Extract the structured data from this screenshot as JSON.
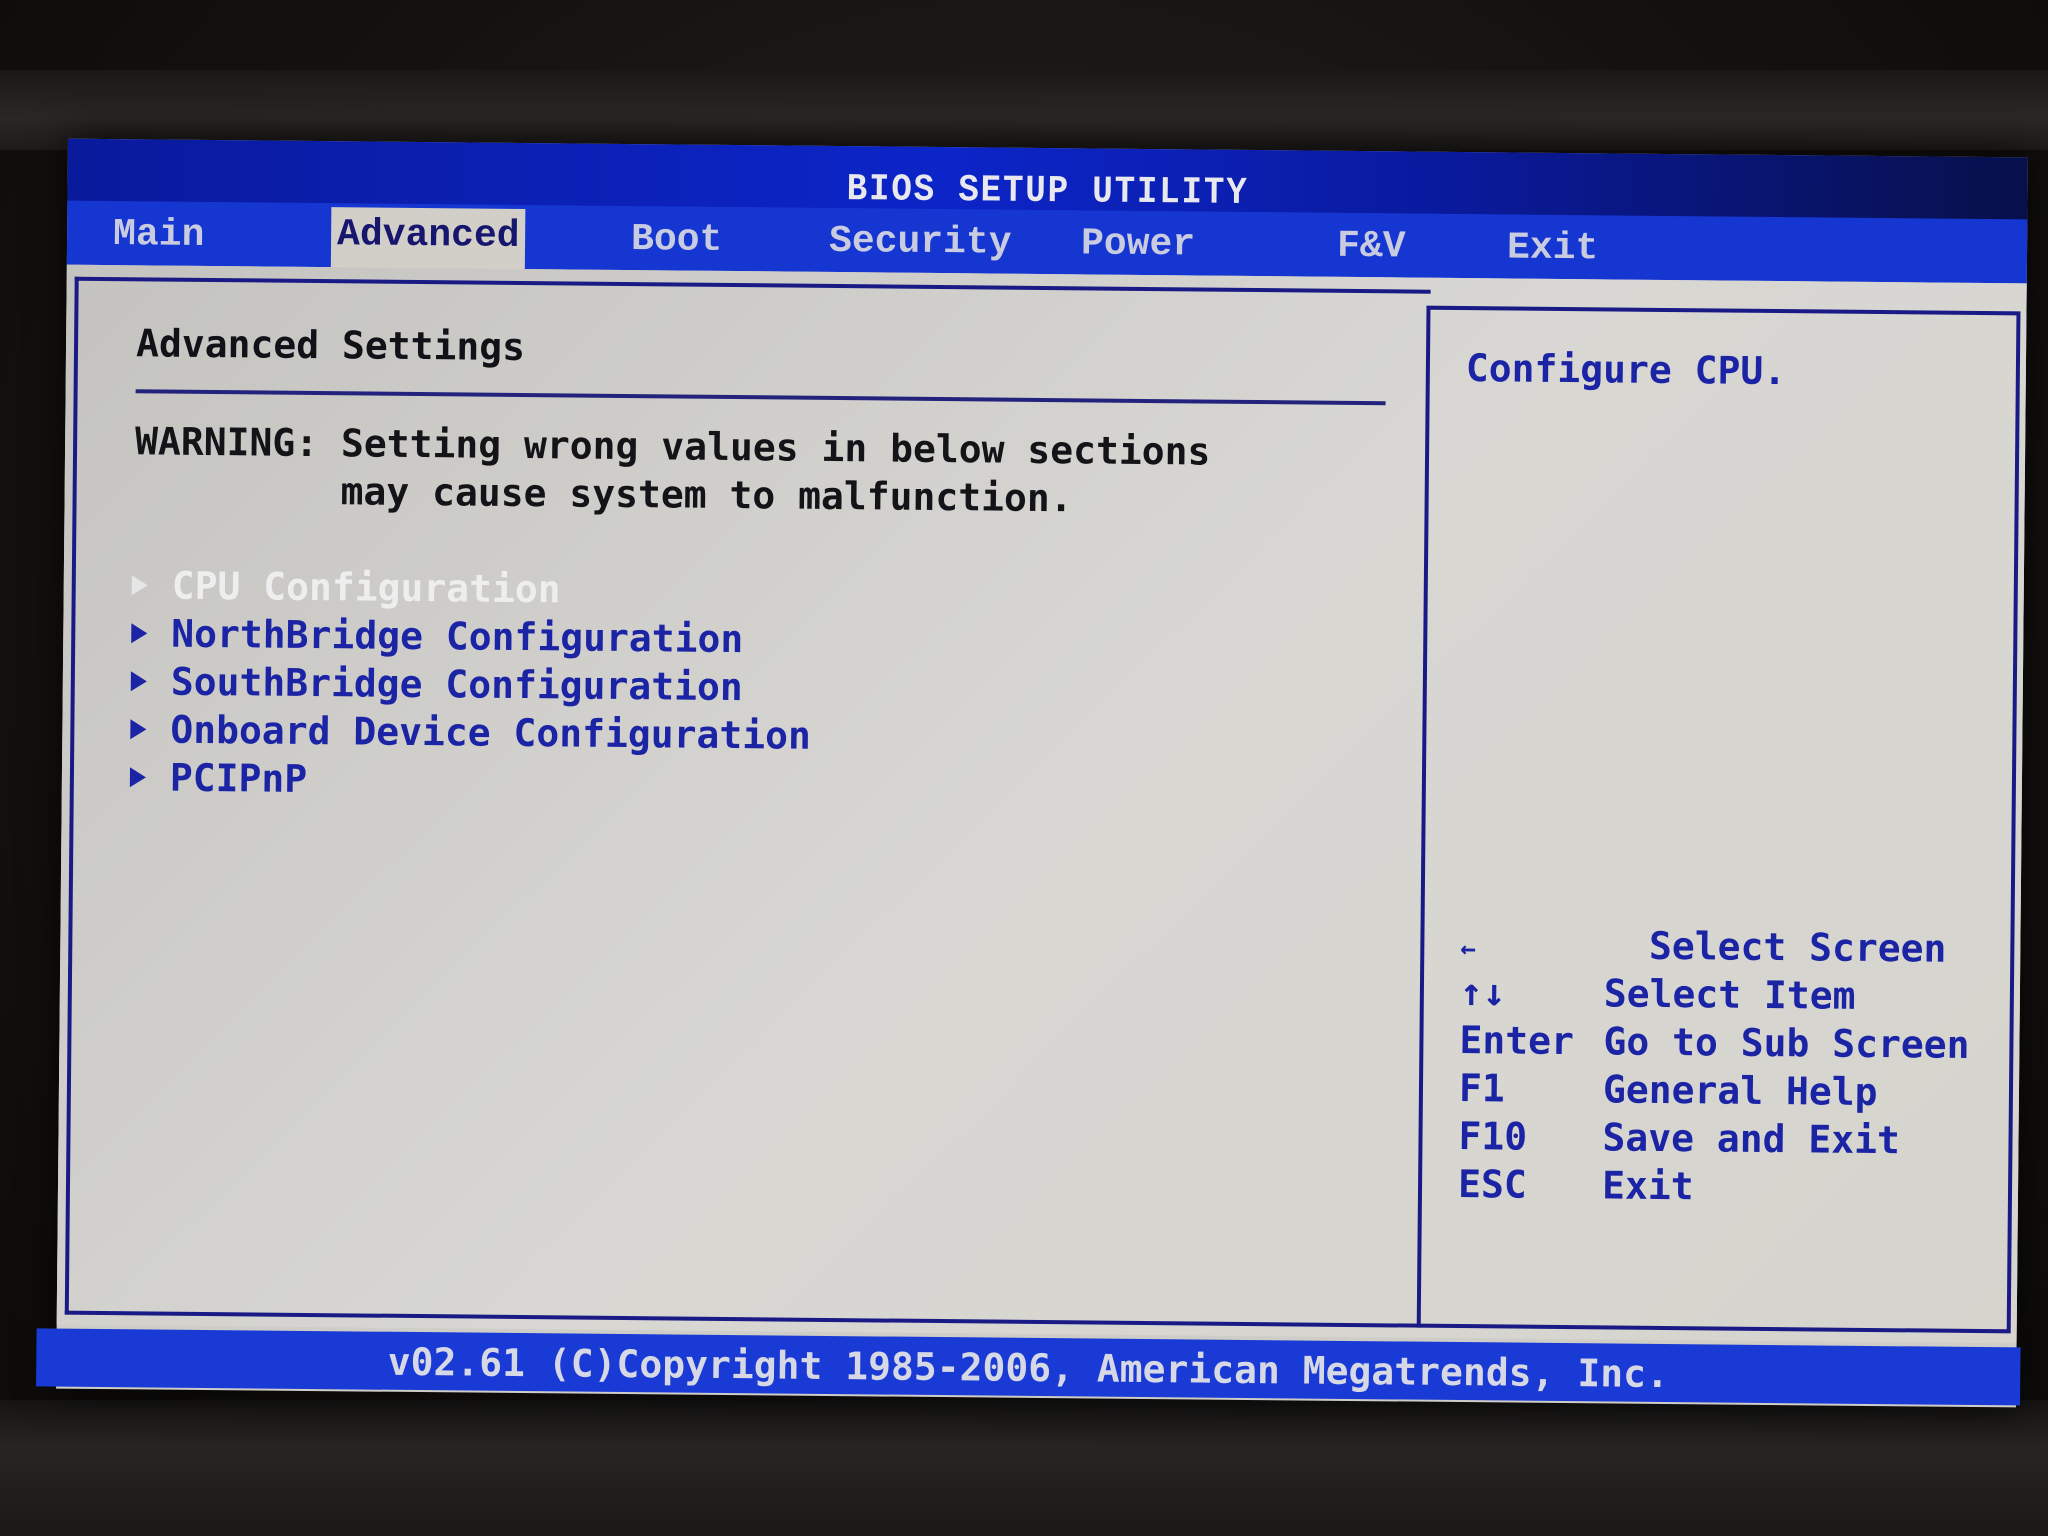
{
  "header": {
    "title": "BIOS SETUP UTILITY"
  },
  "tabs": [
    {
      "label": "Main",
      "active": false
    },
    {
      "label": "Advanced",
      "active": true
    },
    {
      "label": "Boot",
      "active": false
    },
    {
      "label": "Security",
      "active": false
    },
    {
      "label": "Power",
      "active": false
    },
    {
      "label": "F&V",
      "active": false
    },
    {
      "label": "Exit",
      "active": false
    }
  ],
  "main": {
    "section_title": "Advanced Settings",
    "warning_line1": "WARNING: Setting wrong values in below sections",
    "warning_line2": "         may cause system to malfunction.",
    "menu_items": [
      {
        "label": "CPU Configuration",
        "selected": true,
        "icon": "submenu-arrow-icon"
      },
      {
        "label": "NorthBridge Configuration",
        "selected": false,
        "icon": "submenu-arrow-icon"
      },
      {
        "label": "SouthBridge Configuration",
        "selected": false,
        "icon": "submenu-arrow-icon"
      },
      {
        "label": "Onboard Device Configuration",
        "selected": false,
        "icon": "submenu-arrow-icon"
      },
      {
        "label": "PCIPnP",
        "selected": false,
        "icon": "submenu-arrow-icon"
      }
    ]
  },
  "help_panel": {
    "description": "Configure CPU.",
    "keys": [
      {
        "key": "←",
        "action": "   Select Screen"
      },
      {
        "key": "↑↓",
        "action": "Select Item"
      },
      {
        "key": "Enter",
        "action": "Go to Sub Screen"
      },
      {
        "key": "F1",
        "action": "General Help"
      },
      {
        "key": "F10",
        "action": "Save and Exit"
      },
      {
        "key": "ESC",
        "action": "Exit"
      }
    ]
  },
  "footer": {
    "text": "v02.61 (C)Copyright 1985-2006, American Megatrends, Inc."
  },
  "colors": {
    "title_bar": "#0c25c8",
    "tab_bar": "#1636d2",
    "content_bg": "#d2d0ca",
    "text_blue": "#1c24a6",
    "border": "#1a1a86",
    "selected_item": "#eeeeee"
  }
}
